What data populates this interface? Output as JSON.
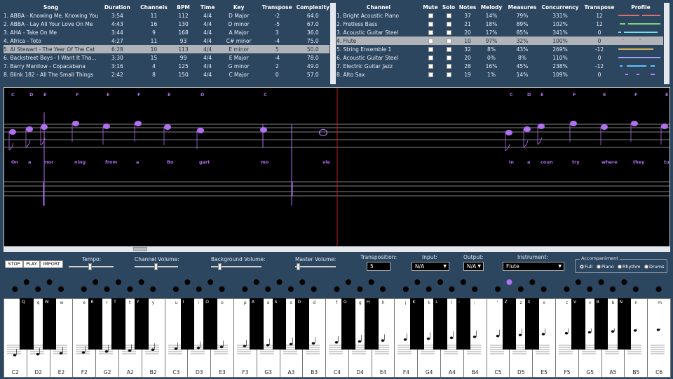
{
  "songs": {
    "headers": [
      "Song",
      "Duration",
      "Channels",
      "BPM",
      "Time",
      "Key",
      "Transpose",
      "Complexity"
    ],
    "rows": [
      [
        "1. ABBA - Knowing Me, Knowing You",
        "3:54",
        "11",
        "112",
        "4/4",
        "D Major",
        "-2",
        "64.0"
      ],
      [
        "2. ABBA - Lay All Your Love On Me",
        "4:43",
        "16",
        "130",
        "4/4",
        "D minor",
        "-5",
        "67.0"
      ],
      [
        "3. AHA - Take On Me",
        "3:44",
        "9",
        "168",
        "4/4",
        "A Major",
        "3",
        "36.0"
      ],
      [
        "4. Africa - Toto",
        "4:27",
        "11",
        "93",
        "4/4",
        "C# minor",
        "-4",
        "75.0"
      ],
      [
        "5. Al Stewart - The Year Of The Cat",
        "6:28",
        "10",
        "113",
        "4/4",
        "E minor",
        "5",
        "50.0"
      ],
      [
        "6. Backstreet Boys - I Want It Tha...",
        "3:30",
        "15",
        "99",
        "4/4",
        "E Major",
        "-4",
        "78.0"
      ],
      [
        "7. Barry Manilow - Copacabana",
        "3:16",
        "4",
        "125",
        "4/4",
        "G minor",
        "2",
        "49.0"
      ],
      [
        "8. Blink 182 - All The Small Things",
        "2:42",
        "8",
        "150",
        "4/4",
        "C Major",
        "0",
        "57.0"
      ]
    ],
    "selected": 4
  },
  "channels": {
    "headers": [
      "Channel",
      "Mute",
      "Solo",
      "Notes",
      "Melody",
      "Measures",
      "Concurrency",
      "Transpose",
      "Profile"
    ],
    "rows": [
      [
        "1. Bright Acoustic Piano",
        "37",
        "14%",
        "79%",
        "331%",
        "12"
      ],
      [
        "2. Fretless Bass",
        "21",
        "18%",
        "89%",
        "102%",
        "12"
      ],
      [
        "3. Acoustic Guitar Steel",
        "20",
        "17%",
        "85%",
        "341%",
        "0"
      ],
      [
        "4. Flute",
        "10",
        "97%",
        "32%",
        "100%",
        "0"
      ],
      [
        "5. String Ensemble 1",
        "32",
        "8%",
        "43%",
        "269%",
        "-12"
      ],
      [
        "6. Acoustic Guitar Steel",
        "20",
        "0%",
        "8%",
        "110%",
        "0"
      ],
      [
        "7. Electric Guitar Jazz",
        "28",
        "16%",
        "45%",
        "238%",
        "-12"
      ],
      [
        "8. Alto Sax",
        "19",
        "1%",
        "14%",
        "109%",
        "0"
      ]
    ],
    "selected": 3,
    "profile_colors": [
      "#e07070",
      "#7fd07f",
      "#70e0f0",
      "#c070e0",
      "#d0b060",
      "#a0a0ff",
      "#60c0ff",
      "#c080ff"
    ]
  },
  "score": {
    "note_names_left": [
      "C",
      "D",
      "E",
      "F",
      "E",
      "F",
      "E",
      "D",
      "C"
    ],
    "note_names_right": [
      "C",
      "D",
      "E",
      "F",
      "E",
      "F",
      "E"
    ],
    "lyrics_left": [
      "On",
      "a",
      "mor",
      "ning",
      "from",
      "a",
      "Bo",
      "gart",
      "mo",
      "vie"
    ],
    "lyrics_right": [
      "In",
      "a",
      "coun",
      "try",
      "where",
      "they",
      "tu"
    ],
    "note_color": "#b070f0"
  },
  "controls": {
    "stop": "STOP",
    "play": "PLAY",
    "import": "IMPORT",
    "tempo": "Tempo:",
    "channel_volume": "Channel Volume:",
    "background_volume": "Background Volume:",
    "master_volume": "Master Volume:",
    "transposition_label": "Transposition:",
    "transposition_value": "5",
    "input_label": "Input:",
    "input_value": "N/A",
    "output_label": "Output:",
    "output_value": "N/A",
    "instrument_label": "Instrument:",
    "instrument_value": "Flute",
    "accompaniment": "Accompaniment",
    "acc_options": [
      "Full",
      "Piano",
      "Rhythm",
      "Drums"
    ],
    "acc_selected": "Full"
  },
  "keyboard": {
    "white_notes": [
      "C2",
      "D2",
      "E2",
      "F2",
      "G2",
      "A2",
      "B2",
      "C3",
      "D3",
      "E3",
      "F3",
      "G3",
      "A3",
      "B3",
      "C4",
      "D4",
      "E4",
      "F4",
      "G4",
      "A4",
      "B4",
      "C5",
      "D5",
      "E5",
      "F5",
      "G5",
      "A5",
      "B5",
      "C6"
    ],
    "white_letters": [
      "",
      "q",
      "w",
      "e",
      "r",
      "t",
      "y",
      "u",
      "i",
      "o",
      "p",
      "a",
      "s",
      "d",
      "f",
      "g",
      "h",
      "j",
      "k",
      "l",
      ";",
      "'",
      "z",
      "x",
      "c",
      "v",
      "b",
      "n",
      "m",
      ","
    ],
    "black_letters": [
      "Q",
      "W",
      "R",
      "T",
      "Y",
      "I",
      "O",
      "A",
      "S",
      "D",
      "G",
      "H",
      "K",
      "L",
      ":",
      "Z",
      "X",
      "V",
      "B",
      "N"
    ]
  }
}
